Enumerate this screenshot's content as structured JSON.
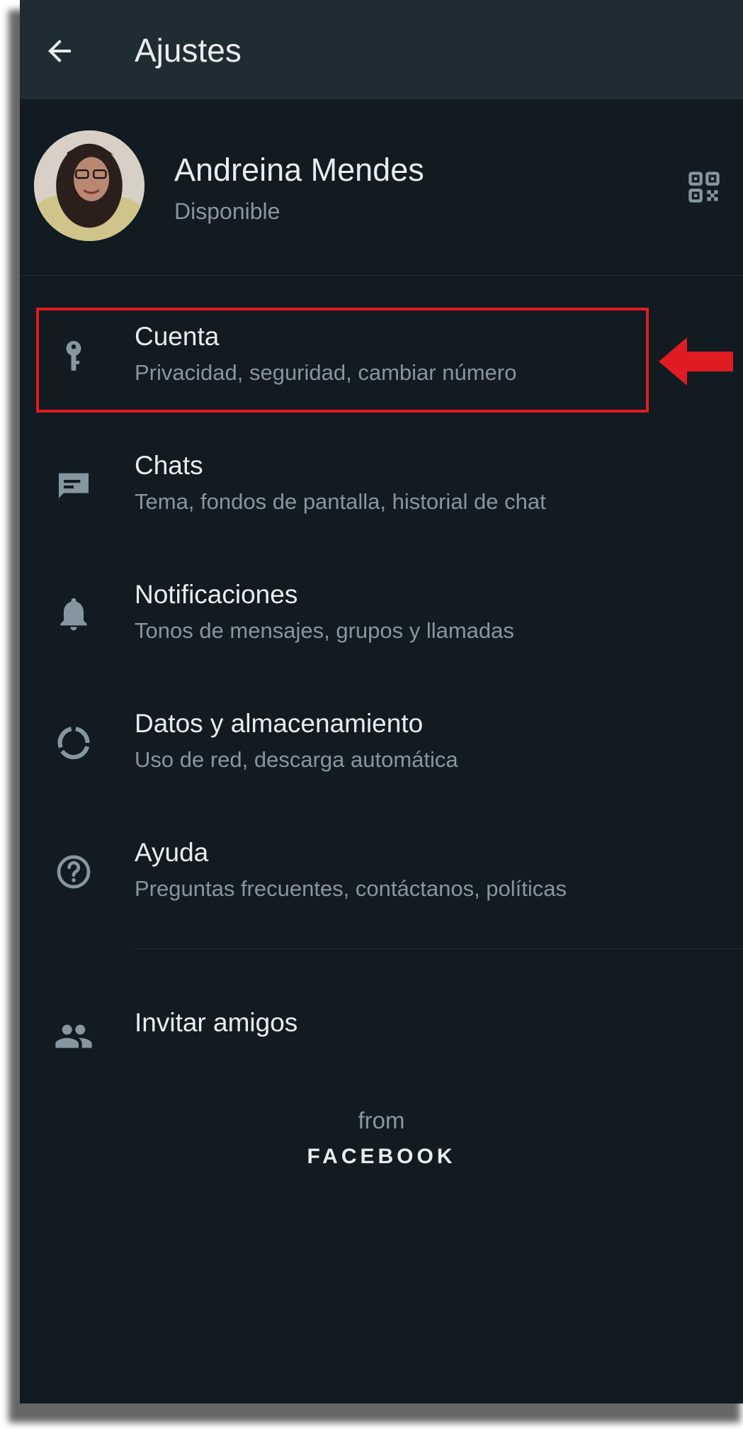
{
  "header": {
    "title": "Ajustes",
    "back_icon": "arrow-left-icon"
  },
  "profile": {
    "name": "Andreina Mendes",
    "status": "Disponible",
    "qr_icon": "qr-code-icon"
  },
  "settings": [
    {
      "label": "Cuenta",
      "subtitle": "Privacidad, seguridad, cambiar número",
      "icon": "key-icon"
    },
    {
      "label": "Chats",
      "subtitle": "Tema, fondos de pantalla, historial de chat",
      "icon": "chat-icon"
    },
    {
      "label": "Notificaciones",
      "subtitle": "Tonos de mensajes, grupos y llamadas",
      "icon": "bell-icon"
    },
    {
      "label": "Datos y almacenamiento",
      "subtitle": "Uso de red, descarga automática",
      "icon": "data-usage-icon"
    },
    {
      "label": "Ayuda",
      "subtitle": "Preguntas frecuentes, contáctanos, políticas",
      "icon": "help-icon"
    }
  ],
  "invite": {
    "label": "Invitar amigos",
    "icon": "people-icon"
  },
  "footer": {
    "from": "from",
    "brand": "FACEBOOK"
  },
  "annotation": {
    "color": "#e11b22"
  },
  "colors": {
    "background": "#121b22",
    "appbar": "#202c33",
    "primary_text": "#e9edef",
    "secondary_text": "#8696a0"
  }
}
